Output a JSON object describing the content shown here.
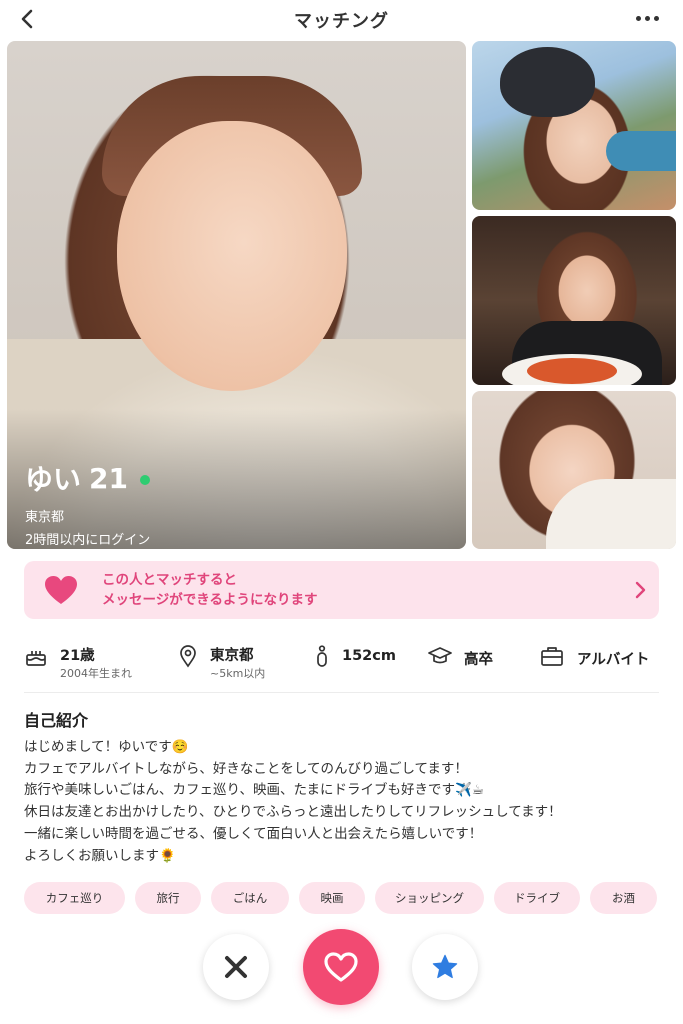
{
  "header": {
    "title": "マッチング"
  },
  "profile": {
    "name": "ゆい",
    "age": "21",
    "location": "東京都",
    "last_login": "2時間以内にログイン",
    "online_color": "#2ecc71"
  },
  "match_banner": {
    "line1": "この人とマッチすると",
    "line2": "メッセージができるようになります",
    "accent": "#e0457b"
  },
  "attributes": {
    "age": {
      "main": "21歳",
      "sub": "2004年生まれ",
      "icon": "cake-icon"
    },
    "location": {
      "main": "東京都",
      "sub": "~5km以内",
      "icon": "location-pin-icon"
    },
    "height": {
      "main": "152cm",
      "icon": "person-icon"
    },
    "education": {
      "main": "高卒",
      "icon": "graduation-cap-icon"
    },
    "job": {
      "main": "アルバイト",
      "icon": "briefcase-icon"
    }
  },
  "intro": {
    "title": "自己紹介",
    "lines": [
      "はじめまして！ゆいです☺️",
      "カフェでアルバイトしながら、好きなことをしてのんびり過ごしてます！",
      "旅行や美味しいごはん、カフェ巡り、映画、たまにドライブも好きです✈️☕",
      "休日は友達とお出かけしたり、ひとりでふらっと遠出したりしてリフレッシュしてます！",
      "一緒に楽しい時間を過ごせる、優しくて面白い人と出会えたら嬉しいです！",
      "よろしくお願いします🌻"
    ]
  },
  "tags": [
    "カフェ巡り",
    "旅行",
    "ごはん",
    "映画",
    "ショッピング",
    "ドライブ",
    "お酒"
  ],
  "colors": {
    "like": "#f24a72",
    "star": "#2f7de1",
    "nope": "#333333",
    "tag_bg": "#fde4ec"
  }
}
